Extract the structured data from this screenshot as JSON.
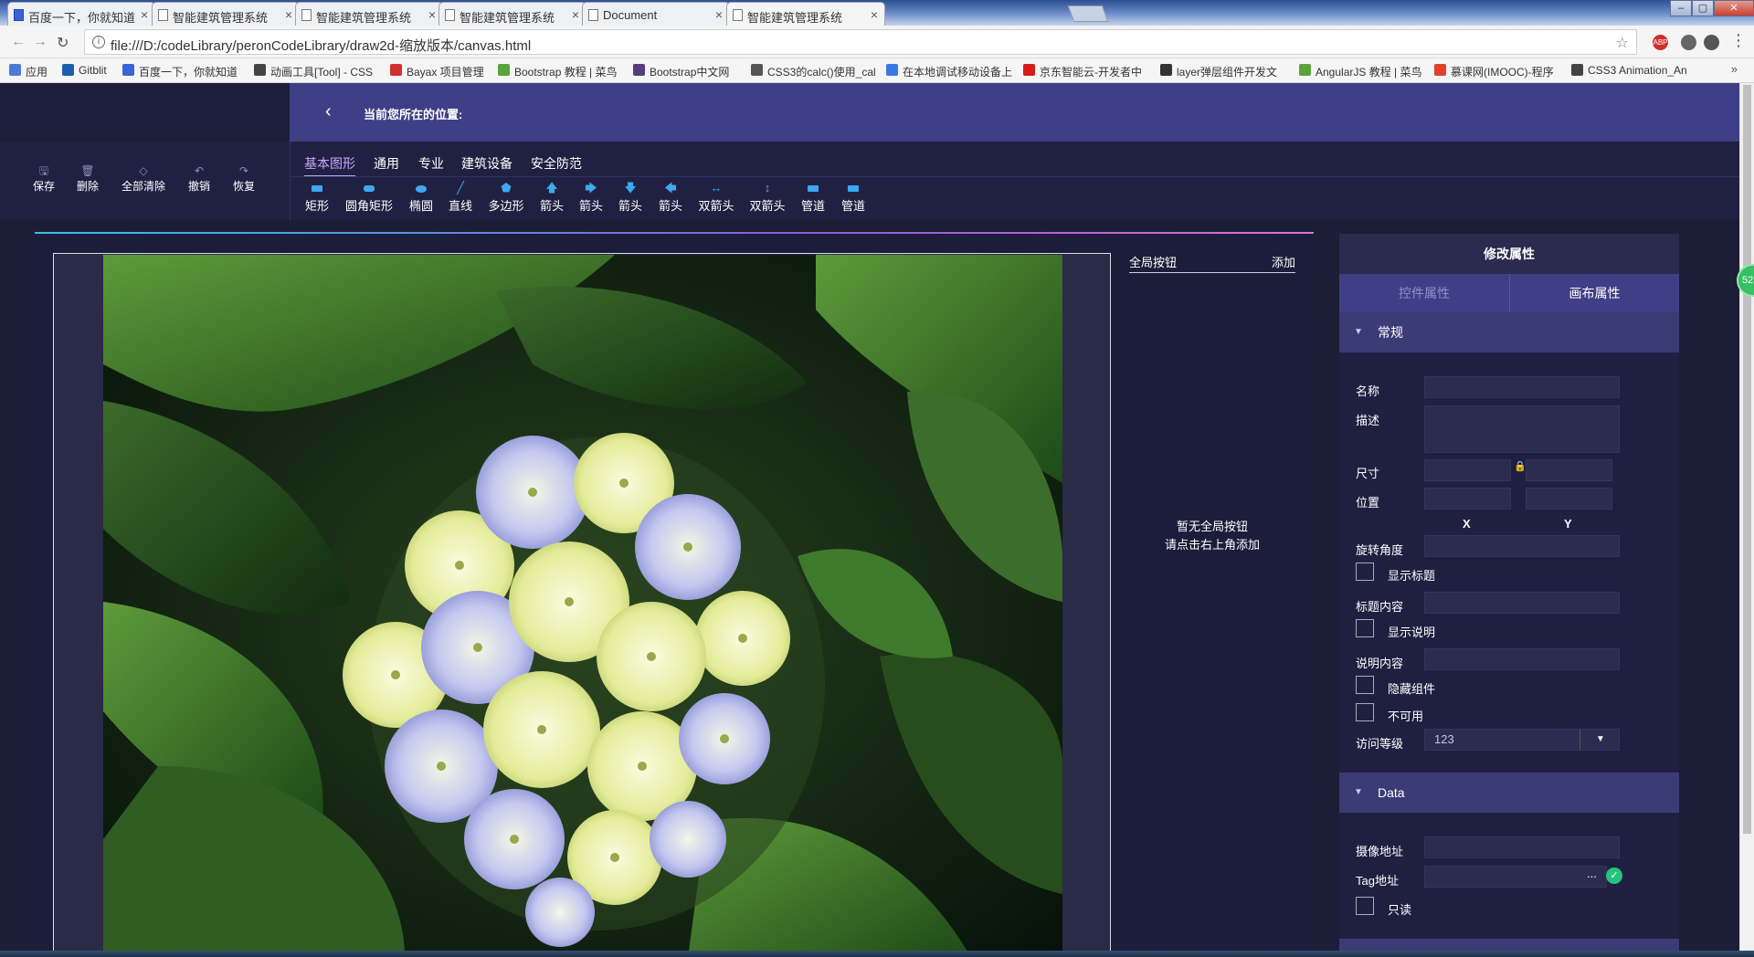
{
  "browser": {
    "tabs": [
      {
        "title": "百度一下，你就知道",
        "icon": "baidu-icon"
      },
      {
        "title": "智能建筑管理系统",
        "icon": "page-icon"
      },
      {
        "title": "智能建筑管理系统",
        "icon": "page-icon"
      },
      {
        "title": "智能建筑管理系统",
        "icon": "page-icon"
      },
      {
        "title": "Document",
        "icon": "page-icon"
      },
      {
        "title": "智能建筑管理系统",
        "icon": "page-icon",
        "active": true
      }
    ],
    "url": "file:///D:/codeLibrary/peronCodeLibrary/draw2d-缩放版本/canvas.html",
    "bookmarks": [
      {
        "label": "应用",
        "color": "#4b7bd6"
      },
      {
        "label": "Gitblit",
        "color": "#1b5fae"
      },
      {
        "label": "百度一下，你就知道",
        "color": "#3a63d6"
      },
      {
        "label": "动画工具[Tool] - CSS",
        "color": "#444"
      },
      {
        "label": "Bayax 项目管理",
        "color": "#d0302b"
      },
      {
        "label": "Bootstrap 教程 | 菜鸟",
        "color": "#5aa33a"
      },
      {
        "label": "Bootstrap中文网",
        "color": "#563d7c"
      },
      {
        "label": "CSS3的calc()使用_cal",
        "color": "#555"
      },
      {
        "label": "在本地调试移动设备上",
        "color": "#3b78e7"
      },
      {
        "label": "京东智能云-开发者中",
        "color": "#d71c1c"
      },
      {
        "label": "layer弹层组件开发文",
        "color": "#333"
      },
      {
        "label": "AngularJS 教程 | 菜鸟",
        "color": "#5aa33a"
      },
      {
        "label": "慕课网(IMOOC)-程序",
        "color": "#e0432a"
      },
      {
        "label": "CSS3 Animation_An",
        "color": "#444"
      }
    ],
    "extensions": [
      {
        "label": "ABP",
        "color": "#d0302b"
      },
      {
        "label": "",
        "color": "#666"
      },
      {
        "label": "",
        "color": "#555"
      }
    ]
  },
  "header": {
    "location_label": "当前您所在的位置:"
  },
  "toolbar": {
    "actions": [
      {
        "label": "保存",
        "icon": "save-icon"
      },
      {
        "label": "删除",
        "icon": "delete-icon"
      },
      {
        "label": "全部清除",
        "icon": "clear-all-icon"
      },
      {
        "label": "撤销",
        "icon": "undo-icon"
      },
      {
        "label": "恢复",
        "icon": "redo-icon"
      }
    ],
    "categories": [
      "基本图形",
      "通用",
      "专业",
      "建筑设备",
      "安全防范"
    ],
    "active_category": "基本图形",
    "shapes": [
      {
        "label": "矩形",
        "icon": "rectangle-icon"
      },
      {
        "label": "圆角矩形",
        "icon": "rounded-rectangle-icon"
      },
      {
        "label": "椭圆",
        "icon": "ellipse-icon"
      },
      {
        "label": "直线",
        "icon": "line-icon"
      },
      {
        "label": "多边形",
        "icon": "polygon-icon"
      },
      {
        "label": "箭头",
        "icon": "arrow-up-icon"
      },
      {
        "label": "箭头",
        "icon": "arrow-right-icon"
      },
      {
        "label": "箭头",
        "icon": "arrow-down-icon"
      },
      {
        "label": "箭头",
        "icon": "arrow-left-icon"
      },
      {
        "label": "双箭头",
        "icon": "double-arrow-horizontal-icon"
      },
      {
        "label": "双箭头",
        "icon": "double-arrow-vertical-icon"
      },
      {
        "label": "管道",
        "icon": "pipe-icon"
      },
      {
        "label": "管道",
        "icon": "pipe-icon"
      }
    ]
  },
  "global_buttons": {
    "title": "全局按钮",
    "add_label": "添加",
    "empty_line1": "暂无全局按钮",
    "empty_line2": "请点击右上角添加"
  },
  "properties": {
    "title": "修改属性",
    "tabs": [
      "控件属性",
      "画布属性"
    ],
    "active_tab": "画布属性",
    "general": {
      "section_title": "常规",
      "name_label": "名称",
      "name_value": "",
      "desc_label": "描述",
      "desc_value": "",
      "size_label": "尺寸",
      "position_label": "位置",
      "x_label": "X",
      "y_label": "Y",
      "rotation_label": "旋转角度",
      "show_title_label": "显示标题",
      "title_content_label": "标题内容",
      "show_desc_label": "显示说明",
      "desc_content_label": "说明内容",
      "hide_label": "隐藏组件",
      "disabled_label": "不可用",
      "access_label": "访问等级",
      "access_value": "123"
    },
    "data": {
      "section_title": "Data",
      "camera_label": "摄像地址",
      "tag_label": "Tag地址",
      "tag_button": "...",
      "readonly_label": "只读"
    }
  },
  "floating_badge": "52",
  "colors": {
    "header_bg": "#3e3f86",
    "panel_bg": "#1f2041",
    "accent_blue": "#3ea8f0",
    "active_tab": "#c8a6ff"
  }
}
